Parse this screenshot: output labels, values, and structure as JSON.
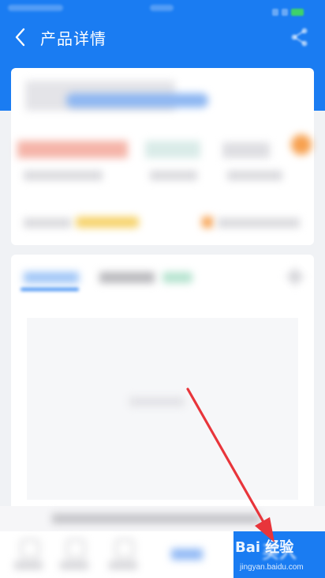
{
  "header": {
    "title": "产品详情",
    "back_icon": "chevron-left-icon",
    "share_icon": "share-icon",
    "color": "#1a7cf2"
  },
  "bottom_bar": {
    "buy_label": "买入",
    "accent": "#1a7cf2"
  },
  "watermark": {
    "main": "Bai 经验",
    "sub": "jingyan.baidu.com"
  },
  "annotation": {
    "arrow_color": "#e8353b"
  }
}
